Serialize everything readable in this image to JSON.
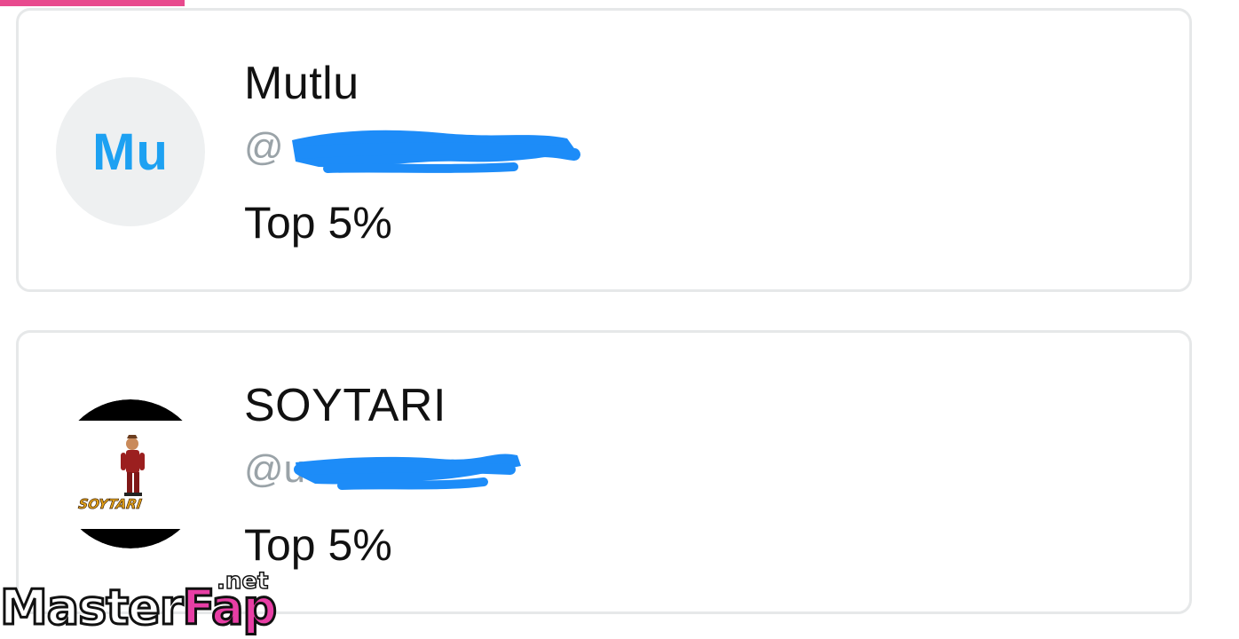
{
  "colors": {
    "accent_bar": "#e84a8e",
    "initials": "#1da1f2",
    "redaction": "#1d8cf8",
    "handle_text": "#9aa3a8",
    "card_border": "#e6e8e9"
  },
  "users": [
    {
      "display_name": "Mutlu",
      "avatar_initials": "Mu",
      "handle_prefix": "@",
      "handle_visible": "",
      "rank": "Top 5%"
    },
    {
      "display_name": "SOYTARI",
      "avatar_caption": "SOYTARI",
      "handle_prefix": "@u",
      "handle_visible": "",
      "rank": "Top 5%"
    }
  ],
  "watermark": {
    "part1": "Master",
    "part2": "Fap",
    "suffix": ".net"
  }
}
